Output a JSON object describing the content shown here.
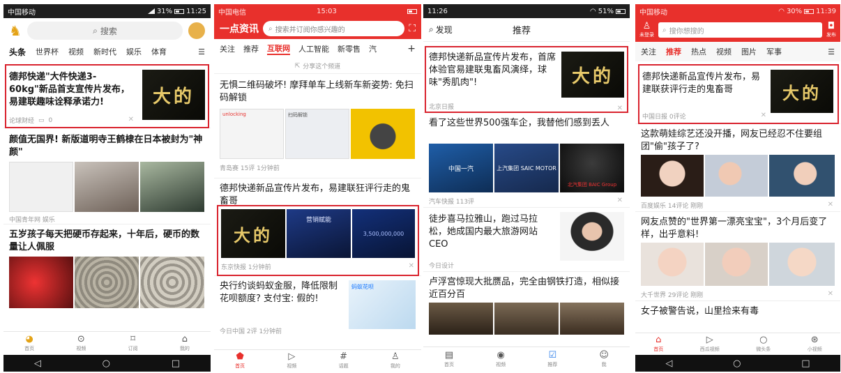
{
  "phone1": {
    "status": {
      "carrier": "中国移动",
      "right": "31%",
      "time": "11:25"
    },
    "search_placeholder": "搜索",
    "tabs": [
      "头条",
      "世界杯",
      "视频",
      "新时代",
      "娱乐",
      "体育"
    ],
    "items": [
      {
        "title": "德邦快递\"大件快递3-60kg\"新品首支宣传片发布，易建联趣味诠释承诺力!",
        "thumb": "大的",
        "source": "论球财经",
        "comments": "0"
      },
      {
        "title": "颜值无国界! 新版道明寺王鹤棣在日本被封为\"神颜\"",
        "source": "中国青年网 娱乐"
      },
      {
        "title": "五岁孩子每天把硬币存起来，十年后，硬币的数量让人佩服"
      }
    ],
    "nav": [
      "首页",
      "视频",
      "订阅",
      "我的"
    ]
  },
  "phone2": {
    "status": {
      "carrier": "中国电信",
      "time": "15:03"
    },
    "logo": "一点资讯",
    "search_placeholder": "搜索并订阅你感兴趣的",
    "tabs": [
      "关注",
      "推荐",
      "互联网",
      "人工智能",
      "新零售",
      "汽"
    ],
    "share": "分享这个频道",
    "items": [
      {
        "title": "无惧二维码破坏! 摩拜单车上线新车新姿势: 免扫码解锁",
        "source": "青岛赛 15评 1分钟前",
        "img1": "unlocking",
        "img2": "扫码解锁"
      },
      {
        "title": "德邦快递新品宣传片发布，易建联狂评行走的鬼畜哥",
        "thumb": "大的",
        "img2": "营销赋能",
        "img3": "3,500,000,000",
        "source": "东京快报 1分钟前"
      },
      {
        "title": "央行约谈蚂蚁金服，降低限制花呗额度? 支付宝: 假的!",
        "source": "今日中国 2评 1分钟前",
        "img": "蚂蚁花呗"
      }
    ],
    "nav": [
      "首页",
      "视频",
      "话题",
      "我的"
    ]
  },
  "phone3": {
    "status": {
      "time": "11:26",
      "right": "51%"
    },
    "left": "发现",
    "center": "推荐",
    "items": [
      {
        "title": "德邦快递新品宣传片发布，首席体验官易建联鬼畜风演绎，球味\"秀肌肉\"!",
        "thumb": "大的",
        "source": "北京日报"
      },
      {
        "title": "看了这些世界500强车企，我替他们感到丢人",
        "source": "汽车快报 113评",
        "logo1": "中国一汽",
        "logo2": "上汽集团 SAIC MOTOR",
        "logo3": "北汽集团 BAIC Group"
      },
      {
        "title": "徒步喜马拉雅山，跑过马拉松，她成国内最大旅游网站CEO",
        "source": "今日设计"
      },
      {
        "title": "卢浮宫惊现大批赝品，完全由钢铁打造，相似接近百分百"
      }
    ],
    "nav": [
      "首页",
      "视频",
      "推荐",
      "我"
    ]
  },
  "phone4": {
    "status": {
      "carrier": "中国移动",
      "right": "30%",
      "time": "11:39"
    },
    "login": "未登录",
    "search_placeholder": "搜你想搜的",
    "publish": "发布",
    "tabs": [
      "关注",
      "推荐",
      "热点",
      "视频",
      "图片",
      "军事"
    ],
    "items": [
      {
        "title": "德邦快递新品宣传片发布，易建联获评行走的鬼畜哥",
        "thumb": "大的",
        "source": "中国日报 0评论"
      },
      {
        "title": "这款萌娃综艺还没开播，网友已经忍不住要组团\"偷\"孩子了?",
        "source": "百度娱乐 14评论 刚刚"
      },
      {
        "title": "网友点赞的\"世界第一漂亮宝宝\"，3个月后变了样，出乎意料!",
        "source": "大千世界 29评论 刚刚"
      },
      {
        "title": "女子被警告说，山里捡来有毒"
      }
    ],
    "nav": [
      "首页",
      "西瓜视频",
      "微头条",
      "小视频"
    ]
  },
  "colors": {
    "brand_red": "#e8302c",
    "highlight": "#d9232e",
    "gold": "#e7c96a"
  }
}
